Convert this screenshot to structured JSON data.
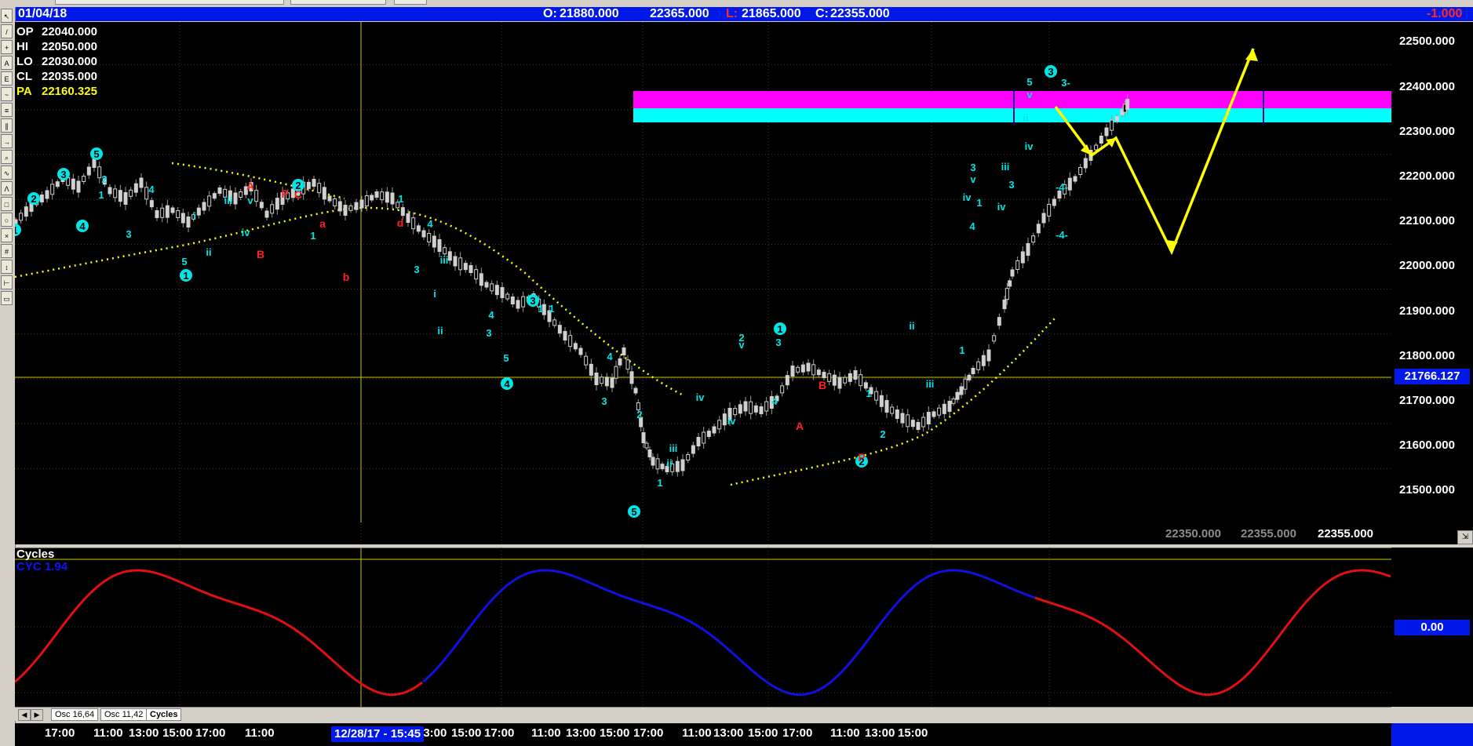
{
  "header": {
    "date": "01/04/18",
    "open_label": "O:",
    "open": "21880.000",
    "high": "22365.000",
    "low_label": "L:",
    "low": "21865.000",
    "close_label": "C:",
    "close": "22355.000",
    "change": "-1.000"
  },
  "ohlc_panel": [
    {
      "key": "OP",
      "value": "22040.000"
    },
    {
      "key": "HI",
      "value": "22050.000"
    },
    {
      "key": "LO",
      "value": "22030.000"
    },
    {
      "key": "CL",
      "value": "22035.000"
    },
    {
      "key": "PA",
      "value": "22160.325"
    }
  ],
  "price_axis": {
    "ticks": [
      "22500.000",
      "22400.000",
      "22300.000",
      "22200.000",
      "22100.000",
      "22000.000",
      "21900.000",
      "21800.000",
      "21700.000",
      "21600.000",
      "21500.000"
    ],
    "cursor_value": "21766.127"
  },
  "bottom_values": [
    "22350.000",
    "22355.000",
    "22355.000"
  ],
  "osc_panel": {
    "title": "Cycles",
    "label": "CYC 1.94",
    "axis_value": "0.00"
  },
  "tabs": [
    "Osc 16,64",
    "Osc 11,42",
    "Cycles"
  ],
  "time_axis": {
    "labels": [
      "17:00",
      "11:00",
      "13:00",
      "15:00",
      "17:00",
      "11:00",
      "0",
      "11:00",
      "13:00",
      "15:00",
      "17:00",
      "11:00",
      "13:00",
      "15:00",
      "17:00",
      "11:00",
      "13:00",
      "15:00",
      "17:00",
      "11:00",
      "13:00",
      "15:00"
    ],
    "cursor_label": "12/28/17 - 15:45"
  },
  "wave_labels": {
    "circled": [
      "1",
      "2",
      "3",
      "4",
      "5",
      "1",
      "2",
      "3",
      "4",
      "5",
      "1",
      "2",
      "3"
    ],
    "plain": [
      "2",
      "1",
      "3",
      "4",
      "i",
      "ii",
      "iii",
      "iv",
      "v",
      "5",
      "1",
      "2",
      "3",
      "4",
      "5",
      "i",
      "ii",
      "iii",
      "iv",
      "v",
      "1",
      "2",
      "3",
      "4",
      "i",
      "ii",
      "iii",
      "iv",
      "v",
      "1",
      "2",
      "3",
      "4",
      "5",
      "-4-",
      "-4-",
      "3-"
    ],
    "red": [
      "A",
      "B",
      "P",
      "C",
      "a",
      "b",
      "d",
      "A",
      "B",
      "P"
    ]
  },
  "colors": {
    "header_bg": "#0018e8",
    "cyan": "#00e5e5",
    "yellow": "#ffff00",
    "magenta": "#ff00ff",
    "red_label": "#ff2020",
    "osc_red": "#e01010",
    "osc_blue": "#1010e0"
  },
  "icons": [
    "toolbar-icons",
    "zoom-icon"
  ]
}
